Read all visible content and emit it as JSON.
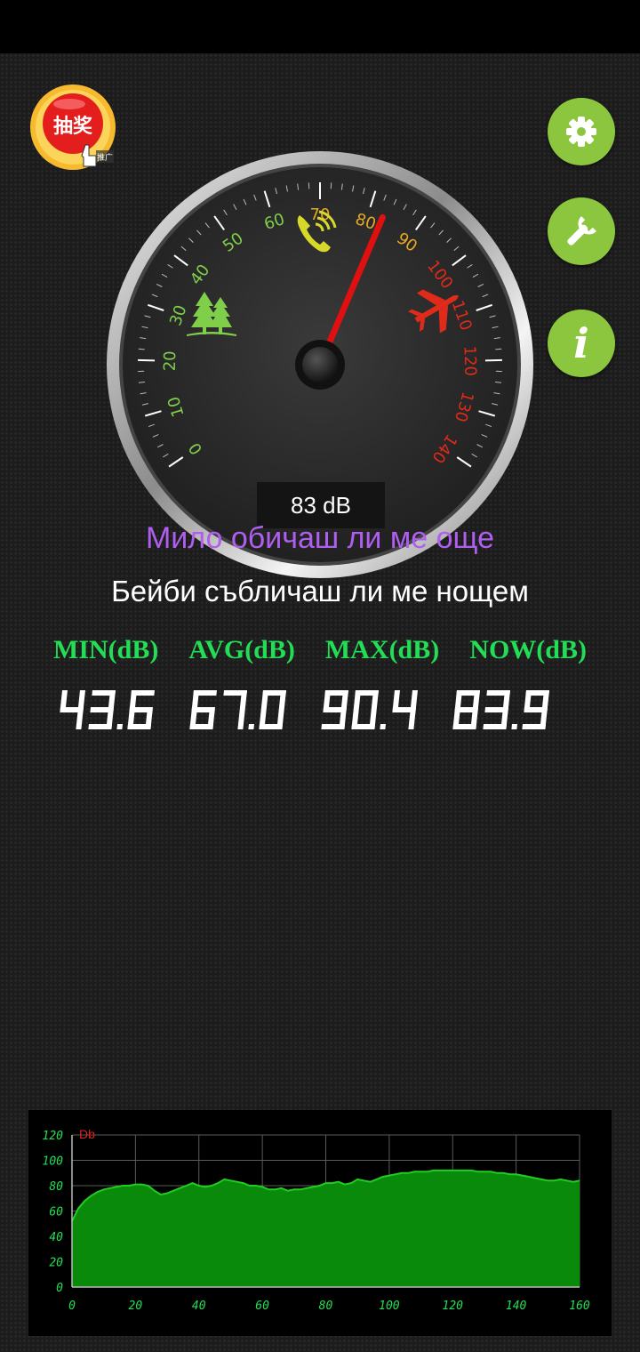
{
  "promo": {
    "label": "抽奖",
    "tag": "推广",
    "icon": "hand-pointer-icon"
  },
  "side_buttons": [
    {
      "icon": "gear-icon"
    },
    {
      "icon": "wrench-icon"
    },
    {
      "icon": "info-icon",
      "glyph": "i"
    }
  ],
  "gauge": {
    "ticks": [
      "0",
      "10",
      "20",
      "30",
      "40",
      "50",
      "60",
      "70",
      "80",
      "90",
      "100",
      "110",
      "120",
      "130",
      "140"
    ],
    "reading": 83,
    "readout": "83 dB",
    "zone_icons": [
      "trees-icon",
      "phone-icon",
      "airplane-icon"
    ],
    "colors": {
      "low": "#7fcf4a",
      "mid": "#e6a825",
      "high": "#e02a1a",
      "needle": "#e01010"
    }
  },
  "lyrics": {
    "line1": "Мило обичаш ли ме още",
    "line2": "Бейби събличаш ли ме нощем"
  },
  "stats": {
    "labels": [
      "MIN(dB)",
      "AVG(dB)",
      "MAX(dB)",
      "NOW(dB)"
    ],
    "values": [
      "43.6",
      "67.0",
      "90.4",
      "83.9"
    ]
  },
  "chart_data": {
    "type": "area",
    "ylabel": "Db",
    "ylim": [
      0,
      120
    ],
    "xlim": [
      0,
      160
    ],
    "xticks": [
      "0",
      "20",
      "40",
      "60",
      "80",
      "100",
      "120",
      "140",
      "160"
    ],
    "yticks": [
      "0",
      "20",
      "40",
      "60",
      "80",
      "100",
      "120"
    ],
    "grid": true,
    "color": "#0a8a0a",
    "line_color": "#22cc22",
    "x": [
      0,
      2,
      4,
      6,
      8,
      10,
      12,
      14,
      16,
      18,
      20,
      22,
      24,
      26,
      28,
      30,
      32,
      34,
      36,
      38,
      40,
      42,
      44,
      46,
      48,
      50,
      52,
      54,
      56,
      58,
      60,
      62,
      64,
      66,
      68,
      70,
      72,
      74,
      76,
      78,
      80,
      82,
      84,
      86,
      88,
      90,
      92,
      94,
      96,
      98,
      100,
      102,
      104,
      106,
      108,
      110,
      112,
      114,
      116,
      118,
      120,
      122,
      124,
      126,
      128,
      130,
      132,
      134,
      136,
      138,
      140,
      142,
      144,
      146,
      148,
      150,
      152,
      154,
      156,
      158,
      160
    ],
    "y": [
      52,
      62,
      68,
      72,
      75,
      77,
      78,
      79,
      80,
      80,
      81,
      81,
      80,
      76,
      73,
      74,
      76,
      78,
      80,
      82,
      80,
      79,
      80,
      82,
      85,
      84,
      83,
      82,
      80,
      80,
      79,
      77,
      77,
      78,
      76,
      77,
      77,
      78,
      79,
      80,
      82,
      82,
      83,
      81,
      82,
      85,
      84,
      83,
      85,
      87,
      88,
      89,
      90,
      90,
      91,
      91,
      91,
      92,
      92,
      92,
      92,
      92,
      92,
      92,
      91,
      91,
      91,
      90,
      90,
      89,
      89,
      88,
      87,
      86,
      85,
      84,
      84,
      85,
      84,
      83,
      84
    ]
  }
}
